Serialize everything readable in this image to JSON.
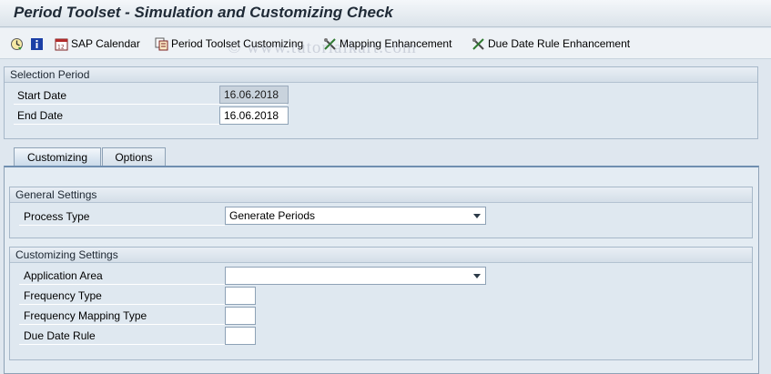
{
  "window": {
    "title": "Period Toolset - Simulation and Customizing Check"
  },
  "toolbar": {
    "execute_icon": "execute-clock-icon",
    "info_icon": "info-icon",
    "sap_calendar": "SAP Calendar",
    "period_toolset_customizing": "Period Toolset Customizing",
    "mapping_enhancement": "Mapping Enhancement",
    "due_date_rule_enhancement": "Due Date Rule Enhancement"
  },
  "watermark": "© www.tutorialkart.com",
  "selection_period": {
    "title": "Selection Period",
    "start_date_label": "Start Date",
    "start_date_value": "16.06.2018",
    "end_date_label": "End Date",
    "end_date_value": "16.06.2018"
  },
  "tabs": {
    "customizing": "Customizing",
    "options": "Options"
  },
  "general_settings": {
    "title": "General Settings",
    "process_type_label": "Process Type",
    "process_type_value": "Generate Periods"
  },
  "customizing_settings": {
    "title": "Customizing Settings",
    "application_area_label": "Application Area",
    "application_area_value": "",
    "frequency_type_label": "Frequency Type",
    "frequency_type_value": "",
    "frequency_mapping_type_label": "Frequency Mapping Type",
    "frequency_mapping_type_value": "",
    "due_date_rule_label": "Due Date Rule",
    "due_date_rule_value": ""
  },
  "colors": {
    "background": "#dfe7ef",
    "group_border": "#a7b8c9",
    "readonly_field": "#c9d3dd"
  }
}
